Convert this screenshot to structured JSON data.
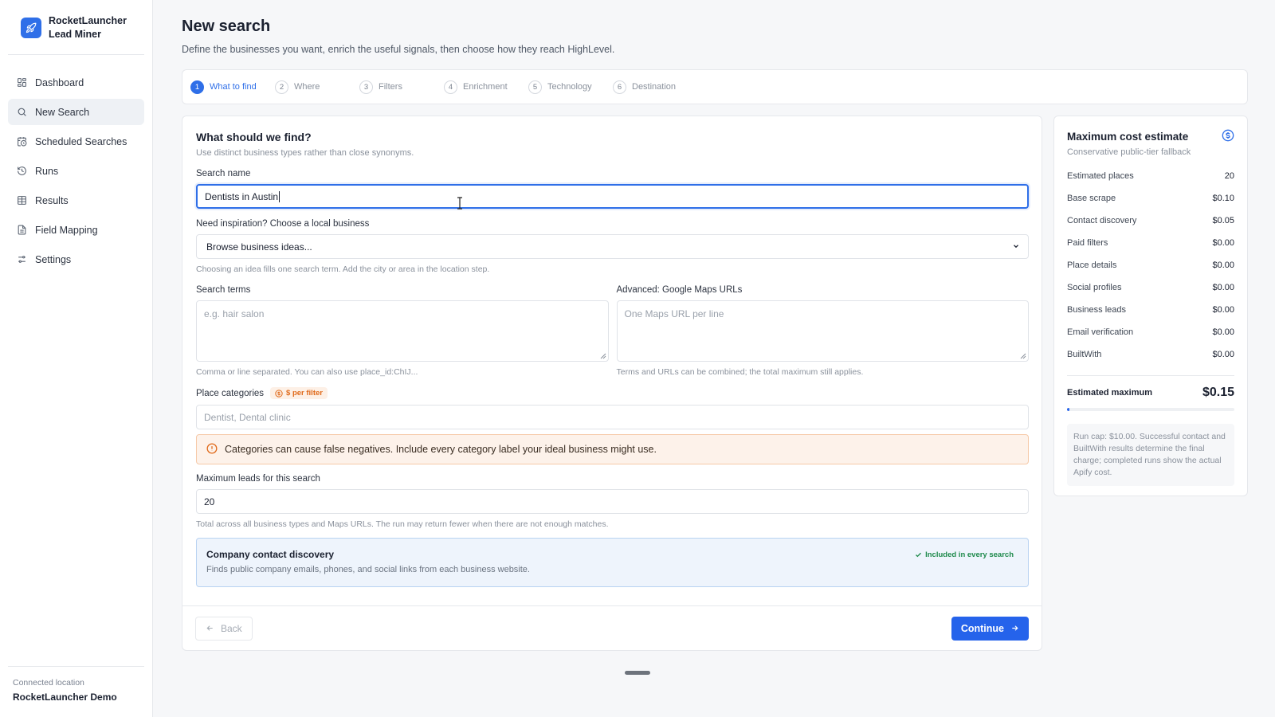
{
  "brand": {
    "line1": "RocketLauncher",
    "line2": "Lead Miner",
    "icon": "rocket-icon",
    "color": "#2f6fe8"
  },
  "nav": [
    {
      "label": "Dashboard",
      "icon": "dashboard-grid-icon",
      "active": false
    },
    {
      "label": "New Search",
      "icon": "search-icon",
      "active": true
    },
    {
      "label": "Scheduled Searches",
      "icon": "calendar-clock-icon",
      "active": false
    },
    {
      "label": "Runs",
      "icon": "history-icon",
      "active": false
    },
    {
      "label": "Results",
      "icon": "table-icon",
      "active": false
    },
    {
      "label": "Field Mapping",
      "icon": "document-icon",
      "active": false
    },
    {
      "label": "Settings",
      "icon": "sliders-icon",
      "active": false
    }
  ],
  "footer": {
    "label": "Connected location",
    "value": "RocketLauncher Demo"
  },
  "page": {
    "title": "New search",
    "subtitle": "Define the businesses you want, enrich the useful signals, then choose how they reach HighLevel."
  },
  "steps": [
    {
      "num": "1",
      "label": "What to find",
      "active": true
    },
    {
      "num": "2",
      "label": "Where",
      "active": false
    },
    {
      "num": "3",
      "label": "Filters",
      "active": false
    },
    {
      "num": "4",
      "label": "Enrichment",
      "active": false
    },
    {
      "num": "5",
      "label": "Technology",
      "active": false
    },
    {
      "num": "6",
      "label": "Destination",
      "active": false
    }
  ],
  "form": {
    "title": "What should we find?",
    "subtitle": "Use distinct business types rather than close synonyms.",
    "search_name": {
      "label": "Search name",
      "value": "Dentists in Austin"
    },
    "inspiration": {
      "label": "Need inspiration? Choose a local business",
      "selected": "Browse business ideas...",
      "help": "Choosing an idea fills one search term. Add the city or area in the location step."
    },
    "search_terms": {
      "label": "Search terms",
      "placeholder": "e.g. hair salon",
      "help": "Comma or line separated. You can also use place_id:ChIJ..."
    },
    "maps_urls": {
      "label": "Advanced: Google Maps URLs",
      "placeholder": "One Maps URL per line",
      "help": "Terms and URLs can be combined; the total maximum still applies."
    },
    "categories": {
      "label": "Place categories",
      "badge": "$ per filter",
      "placeholder": "Dentist, Dental clinic"
    },
    "warning": "Categories can cause false negatives. Include every category label your ideal business might use.",
    "max_leads": {
      "label": "Maximum leads for this search",
      "value": "20",
      "help": "Total across all business types and Maps URLs. The run may return fewer when there are not enough matches."
    },
    "contact_discovery": {
      "title": "Company contact discovery",
      "subtitle": "Finds public company emails, phones, and social links from each business website.",
      "badge": "Included in every search"
    },
    "back_label": "Back",
    "continue_label": "Continue"
  },
  "cost": {
    "title": "Maximum cost estimate",
    "subtitle": "Conservative public-tier fallback",
    "rows": [
      {
        "label": "Estimated places",
        "value": "20"
      },
      {
        "label": "Base scrape",
        "value": "$0.10"
      },
      {
        "label": "Contact discovery",
        "value": "$0.05"
      },
      {
        "label": "Paid filters",
        "value": "$0.00"
      },
      {
        "label": "Place details",
        "value": "$0.00"
      },
      {
        "label": "Social profiles",
        "value": "$0.00"
      },
      {
        "label": "Business leads",
        "value": "$0.00"
      },
      {
        "label": "Email verification",
        "value": "$0.00"
      },
      {
        "label": "BuiltWith",
        "value": "$0.00"
      }
    ],
    "total_label": "Estimated maximum",
    "total_value": "$0.15",
    "progress_fraction": 0.015,
    "note": "Run cap: $10.00. Successful contact and BuiltWith results determine the final charge; completed runs show the actual Apify cost."
  },
  "colors": {
    "accent": "#2563eb",
    "warning_bg": "#fdf2ea",
    "info_bg": "#eef4fc",
    "success": "#1f8a4c"
  }
}
